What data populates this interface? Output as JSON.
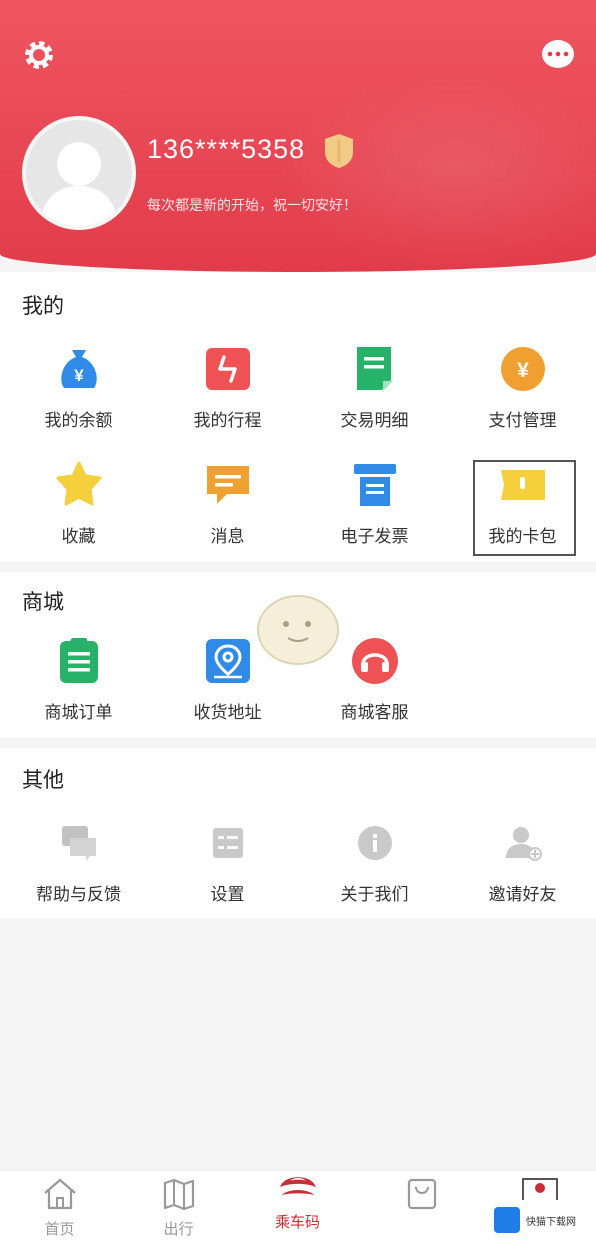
{
  "header": {
    "phone": "136****5358",
    "motto": "每次都是新的开始，祝一切安好！"
  },
  "sections": {
    "mine": {
      "title": "我的",
      "items": [
        {
          "label": "我的余额",
          "icon": "money-bag-icon"
        },
        {
          "label": "我的行程",
          "icon": "route-icon"
        },
        {
          "label": "交易明细",
          "icon": "document-icon"
        },
        {
          "label": "支付管理",
          "icon": "yuan-coin-icon"
        },
        {
          "label": "收藏",
          "icon": "star-icon"
        },
        {
          "label": "消息",
          "icon": "message-icon"
        },
        {
          "label": "电子发票",
          "icon": "invoice-icon"
        },
        {
          "label": "我的卡包",
          "icon": "card-wallet-icon"
        }
      ]
    },
    "mall": {
      "title": "商城",
      "items": [
        {
          "label": "商城订单",
          "icon": "order-clipboard-icon"
        },
        {
          "label": "收货地址",
          "icon": "location-pin-icon"
        },
        {
          "label": "商城客服",
          "icon": "headset-icon"
        }
      ]
    },
    "other": {
      "title": "其他",
      "items": [
        {
          "label": "帮助与反馈",
          "icon": "feedback-icon"
        },
        {
          "label": "设置",
          "icon": "settings-list-icon"
        },
        {
          "label": "关于我们",
          "icon": "info-icon"
        },
        {
          "label": "邀请好友",
          "icon": "add-user-icon"
        }
      ]
    }
  },
  "tabbar": [
    {
      "label": "首页",
      "icon": "home-icon"
    },
    {
      "label": "出行",
      "icon": "map-icon"
    },
    {
      "label": "乘车码",
      "icon": "qr-ride-icon"
    },
    {
      "label": "",
      "icon": "shopping-bag-icon"
    },
    {
      "label": "",
      "icon": "profile-icon"
    }
  ],
  "watermark": {
    "text": "快猫下载网"
  },
  "colors": {
    "brand": "#e23c4b",
    "accent_blue": "#2f8be6",
    "accent_orange": "#f0a030",
    "accent_green": "#27b26a"
  }
}
